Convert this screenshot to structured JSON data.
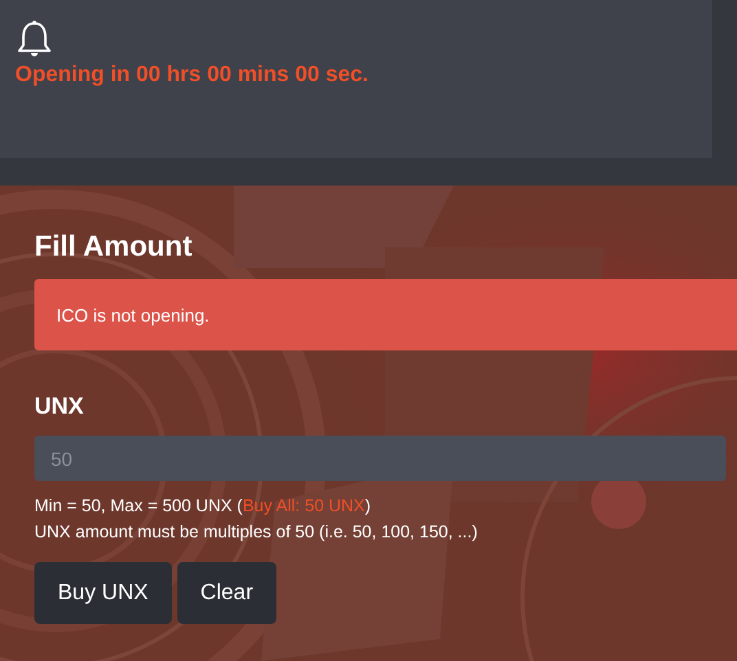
{
  "notice": {
    "countdown": "Opening in 00 hrs 00 mins 00 sec."
  },
  "form": {
    "title": "Fill Amount",
    "alert": "ICO is not opening.",
    "field_label": "UNX",
    "amount_field": {
      "placeholder": "50"
    },
    "limits": {
      "before": "Min = 50, Max = 500 UNX (",
      "link": "Buy All: 50 UNX",
      "after": ")"
    },
    "rule": "UNX amount must be multiples of 50 (i.e. 50, 100, 150, ...)",
    "buttons": [
      "Buy UNX",
      "Clear"
    ]
  }
}
